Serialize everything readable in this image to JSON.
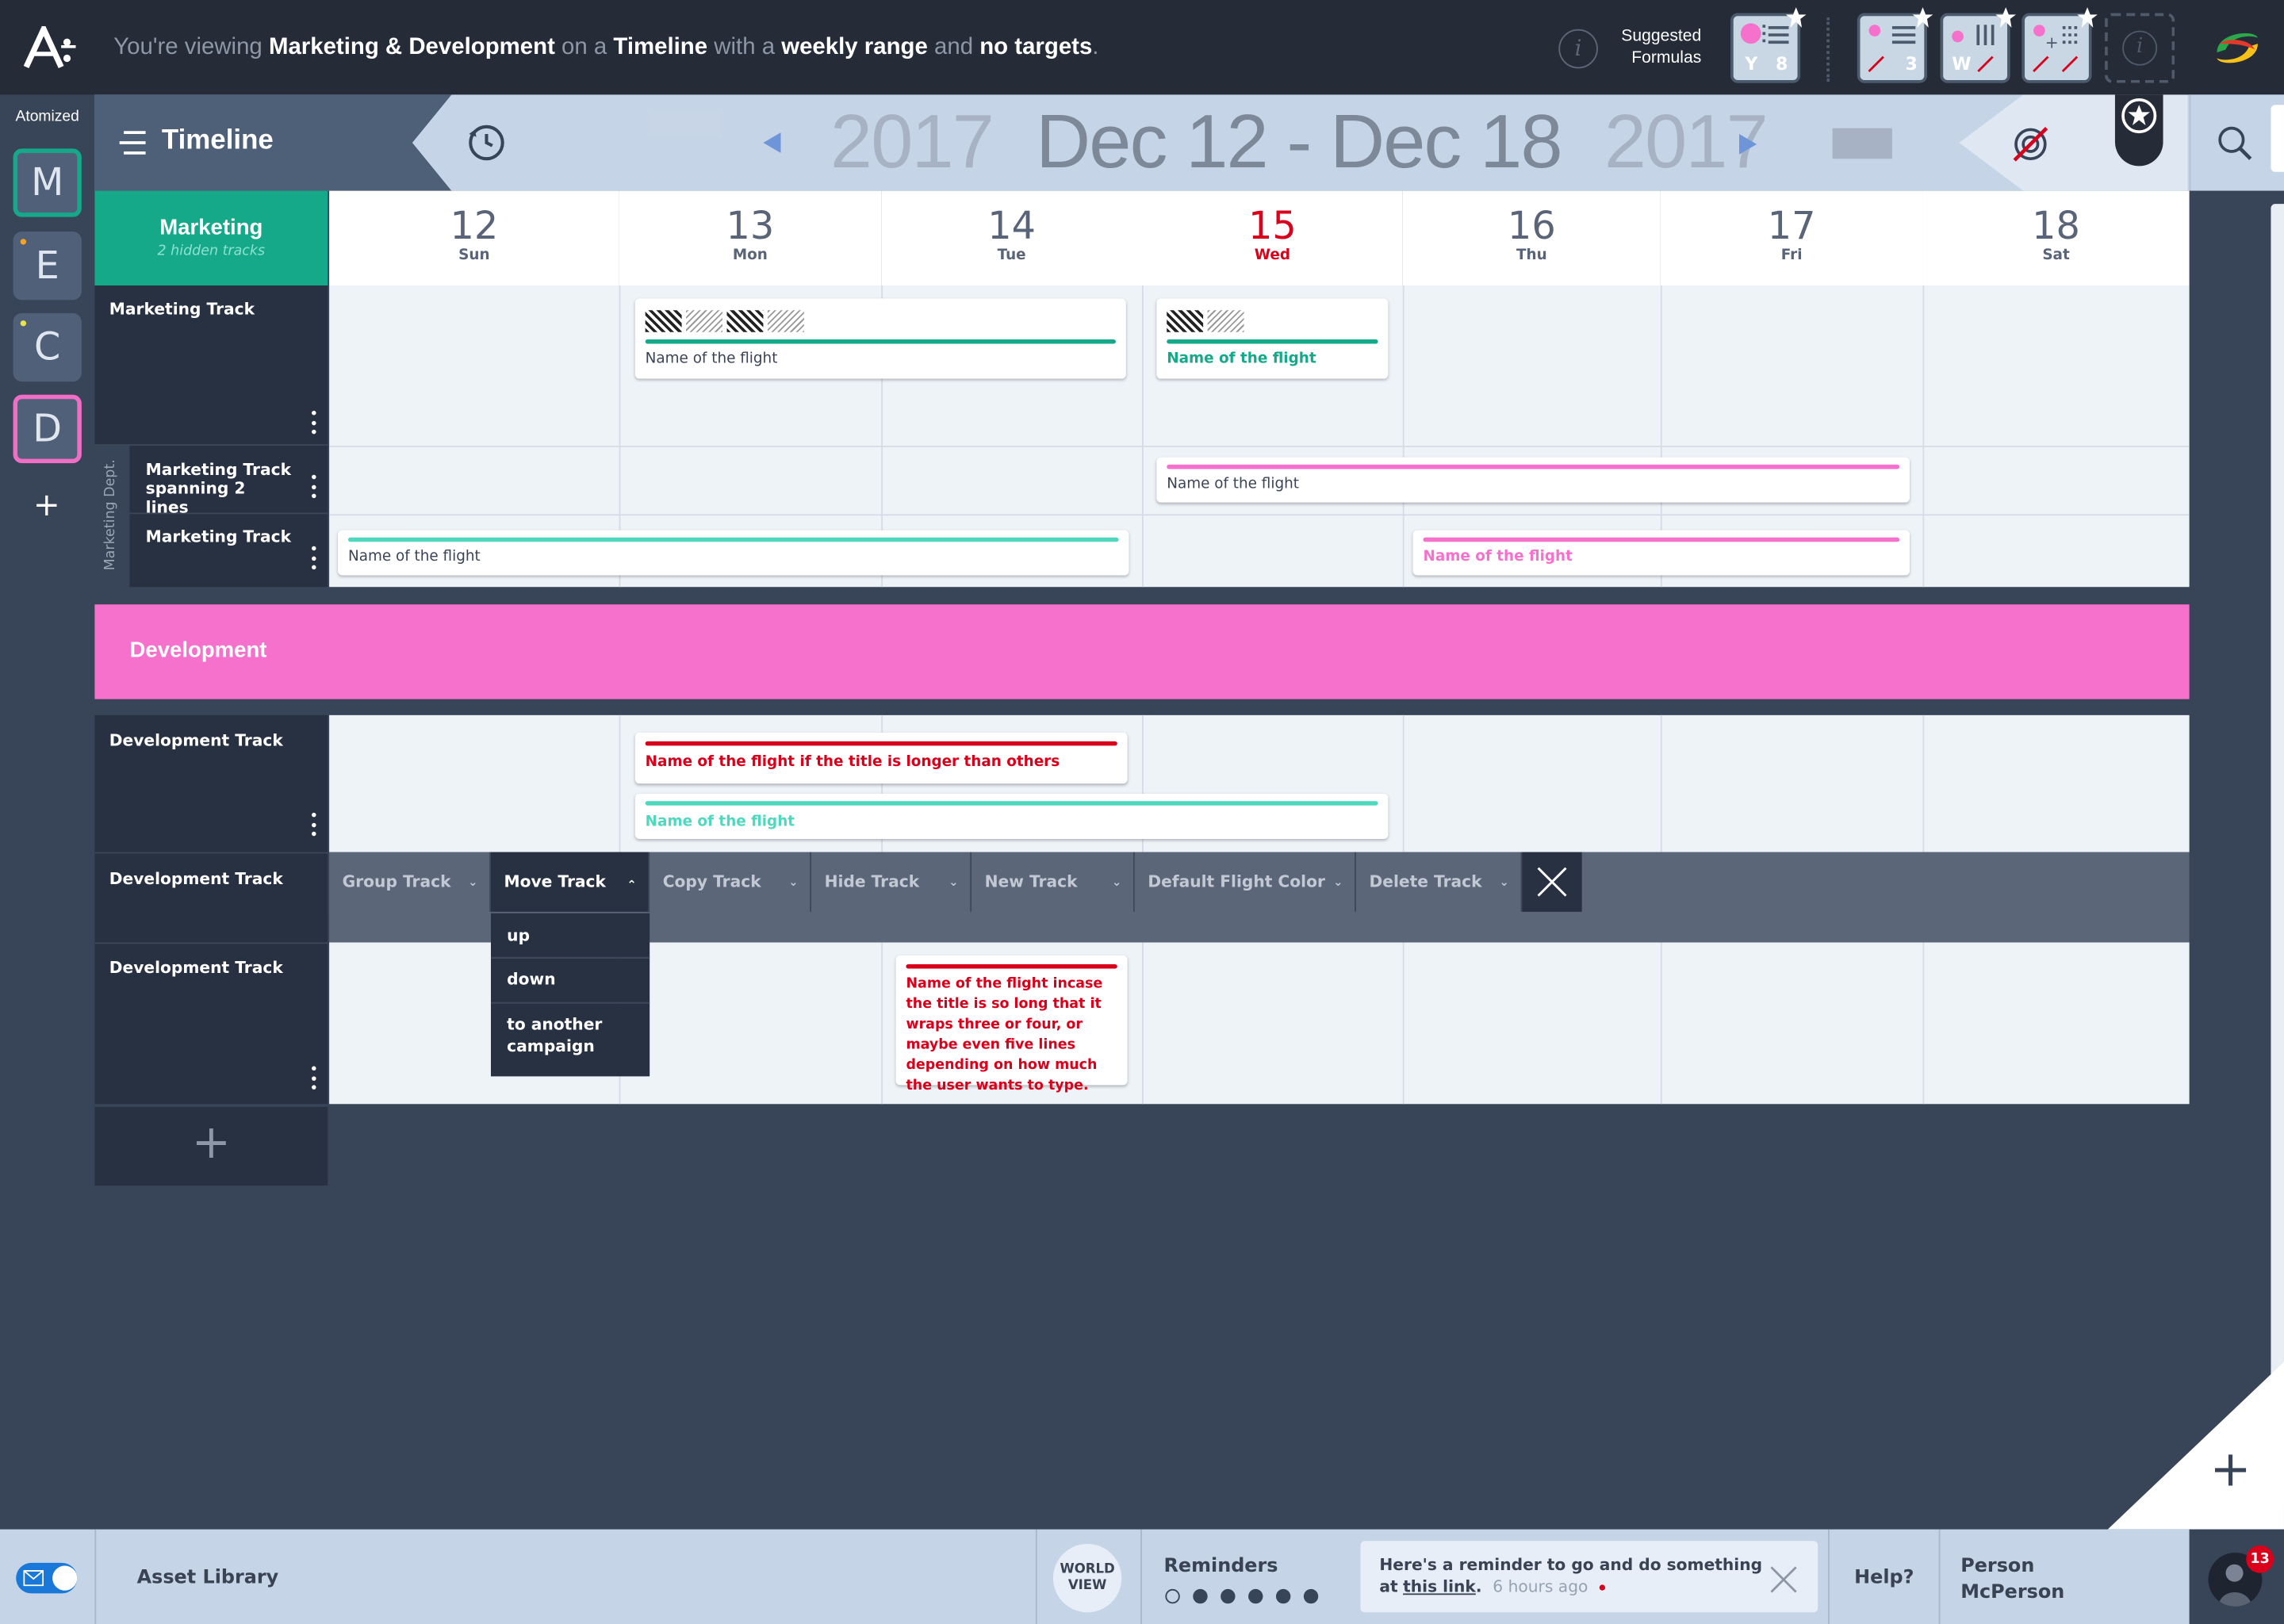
{
  "app": {
    "logo_text": "A:",
    "brand_label": "Atomized",
    "logo_icon": "atomized-logo-icon",
    "user_logo_icon": "swirl-logo-icon"
  },
  "topbar": {
    "viewing_prefix": "You're viewing",
    "viewing_name": "Marketing & Development",
    "on_a": "on a",
    "view_type": "Timeline",
    "with_a": "with a",
    "range": "weekly range",
    "and": "and",
    "targets": "no targets",
    "period": ".",
    "suggested_label_1": "Suggested",
    "suggested_label_2": "Formulas",
    "formula_1_letter": "Y",
    "formula_1_num": "8",
    "formula_2_num": "3",
    "formula_3_letter": "W"
  },
  "rail": {
    "items": [
      {
        "letter": "M",
        "border": "#15a98a"
      },
      {
        "letter": "E",
        "dot": "#f6a32a"
      },
      {
        "letter": "C",
        "dot": "#e9e253"
      },
      {
        "letter": "D",
        "border": "#f06ec5"
      }
    ],
    "add_label": "+"
  },
  "header": {
    "menu_title": "Timeline",
    "year_left": "2017",
    "range": "Dec 12 - Dec 18",
    "year_right": "2017"
  },
  "days": [
    {
      "num": "12",
      "name": "Sun",
      "today": false
    },
    {
      "num": "13",
      "name": "Mon",
      "today": false
    },
    {
      "num": "14",
      "name": "Tue",
      "today": false
    },
    {
      "num": "15",
      "name": "Wed",
      "today": true
    },
    {
      "num": "16",
      "name": "Thu",
      "today": false
    },
    {
      "num": "17",
      "name": "Fri",
      "today": false
    },
    {
      "num": "18",
      "name": "Sat",
      "today": false
    }
  ],
  "marketing": {
    "group_name": "Marketing",
    "hidden_tracks": "2 hidden tracks",
    "dept_label": "Marketing Dept.",
    "track_1": "Marketing Track",
    "track_2": "Marketing Track spanning 2 lines",
    "track_3": "Marketing Track",
    "flight_1": "Name of the flight",
    "flight_2": "Name of the flight",
    "flight_3": "Name of the flight",
    "flight_4": "Name of the flight",
    "flight_5": "Name of the flight"
  },
  "development": {
    "group_name": "Development",
    "track_1": "Development Track",
    "track_2": "Development Track",
    "track_3": "Development Track",
    "flight_1": "Name of the flight if the title is longer than others",
    "flight_2": "Name of the flight",
    "flight_3": "Name of the flight incase the title is so long that it wraps three or four, or maybe even five lines depending on how much the user wants to type."
  },
  "track_menu": {
    "items": [
      "Group Track",
      "Move Track",
      "Copy Track",
      "Hide Track",
      "New Track",
      "Default Flight Color",
      "Delete Track"
    ],
    "move_options": [
      "up",
      "down",
      "to another campaign"
    ]
  },
  "add_track_label": "+",
  "fab_label": "+",
  "bottombar": {
    "asset_library": "Asset Library",
    "world_view_1": "WORLD",
    "world_view_2": "VIEW",
    "reminders": "Reminders",
    "reminder_text_1": "Here's a reminder to go and do something",
    "reminder_text_2": "at",
    "reminder_link": "this link",
    "reminder_period": ".",
    "reminder_time": "6 hours ago",
    "help": "Help?",
    "person_1": "Person",
    "person_2": "McPerson",
    "notification_count": "13"
  },
  "colors": {
    "teal": "#15a98a",
    "pink": "#f571cc",
    "red": "#d9001b",
    "mint": "#4fd8bd",
    "today": "#d9001b"
  }
}
